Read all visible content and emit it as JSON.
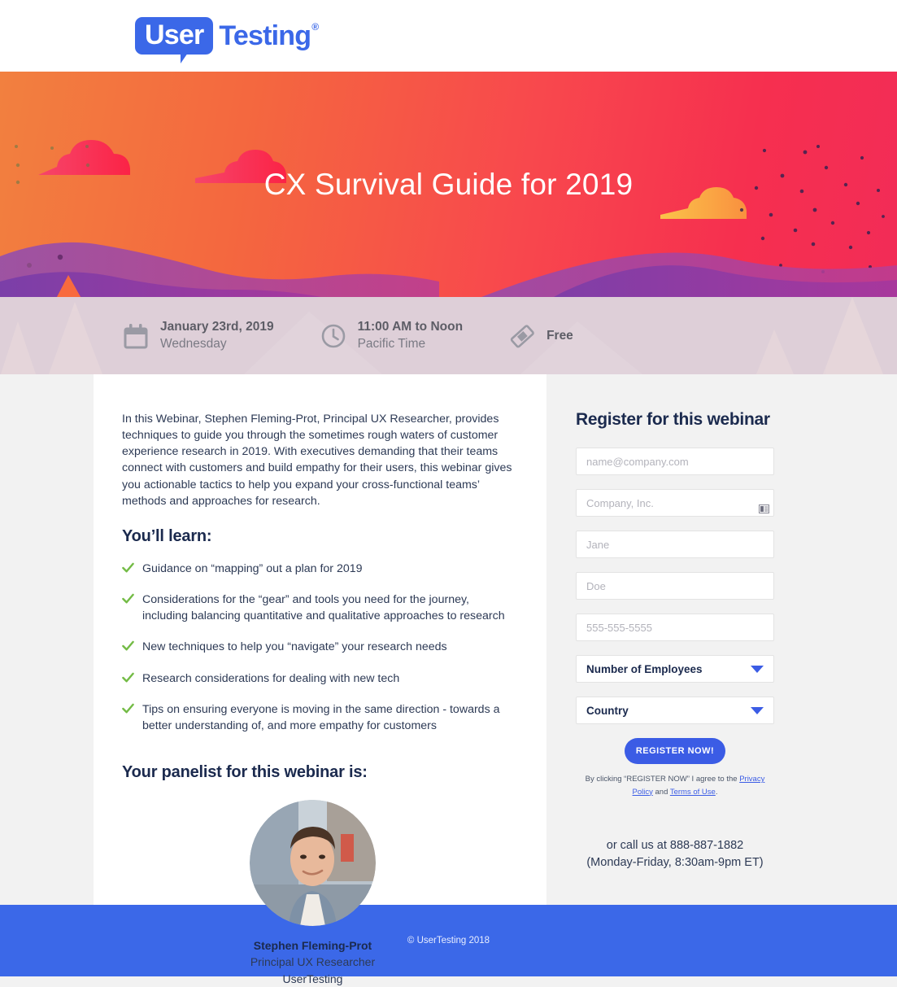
{
  "header": {
    "logo_bubble": "User",
    "logo_word": "Testing",
    "logo_reg": "®"
  },
  "hero": {
    "title": "CX Survival Guide for 2019",
    "gradient_start": "#f2803f",
    "gradient_end": "#f22c57"
  },
  "info_bar": {
    "items": [
      {
        "icon": "calendar-icon",
        "primary": "January 23rd, 2019",
        "secondary": "Wednesday"
      },
      {
        "icon": "clock-icon",
        "primary": "11:00 AM to Noon",
        "secondary": "Pacific Time"
      },
      {
        "icon": "ticket-icon",
        "primary": "Free",
        "secondary": ""
      }
    ]
  },
  "main": {
    "intro": "In this Webinar, Stephen Fleming-Prot, Principal UX Researcher, provides techniques to guide you through the sometimes rough waters of customer experience research in 2019. With executives demanding that their teams connect with customers and build empathy for their users, this webinar gives you actionable tactics to help you expand your cross-functional teams’ methods and approaches for research.",
    "learn_heading": "You’ll learn:",
    "bullets": [
      "Guidance on “mapping” out a plan for 2019",
      "Considerations for the “gear” and tools you need for the journey, including balancing quantitative and qualitative approaches to research",
      "New techniques to help you “navigate” your research needs",
      "Research considerations for dealing with new tech",
      "Tips on ensuring everyone is moving in the same direction - towards a better understanding of, and more empathy for customers"
    ],
    "panelist_heading": "Your panelist for this webinar is:",
    "panelist": {
      "name": "Stephen Fleming-Prot",
      "role": "Principal UX Researcher",
      "org": "UserTesting"
    }
  },
  "form": {
    "title": "Register for this webinar",
    "fields": [
      {
        "name": "email",
        "placeholder": "name@company.com",
        "value": ""
      },
      {
        "name": "company",
        "placeholder": "Company, Inc.",
        "value": ""
      },
      {
        "name": "first-name",
        "placeholder": "Jane",
        "value": ""
      },
      {
        "name": "last-name",
        "placeholder": "Doe",
        "value": ""
      },
      {
        "name": "phone",
        "placeholder": "555-555-5555",
        "value": ""
      }
    ],
    "selects": [
      {
        "name": "employees",
        "label": "Number of Employees"
      },
      {
        "name": "country",
        "label": "Country"
      }
    ],
    "submit_label": "REGISTER NOW!",
    "disclaimer_prefix": "By clicking “REGISTER NOW” I agree to the ",
    "privacy_link": "Privacy Policy",
    "disclaimer_middle": " and ",
    "terms_link": "Terms of Use",
    "disclaimer_suffix": ".",
    "call_line1": "or call us at 888-887-1882",
    "call_line2": "(Monday-Friday, 8:30am-9pm ET)",
    "accent_color": "#3b5ce5"
  },
  "footer": {
    "copyright": "© UserTesting 2018",
    "background": "#3b68e8"
  }
}
